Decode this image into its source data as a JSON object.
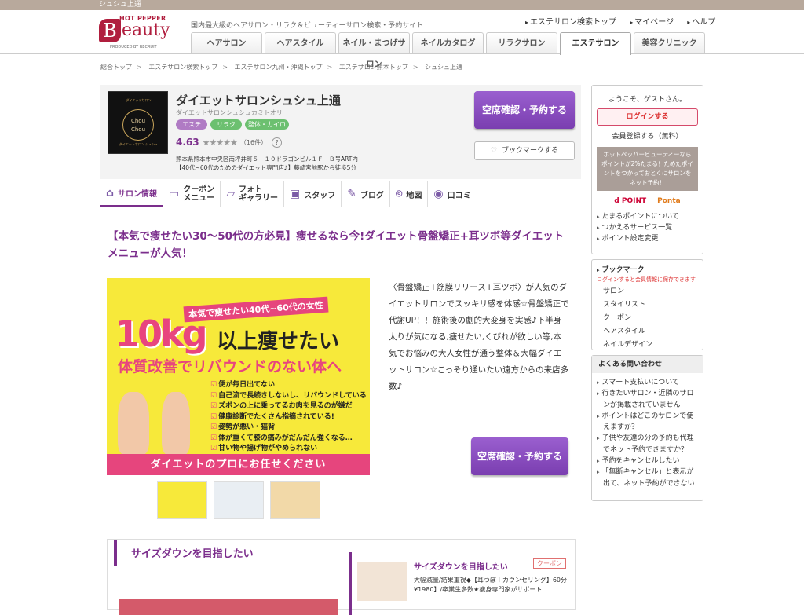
{
  "topstrip": "シュシュ上通",
  "header": {
    "logo_top": "HOT PEPPER",
    "logo_b": "B",
    "logo_rest": "eauty",
    "logo_by": "PRODUCED BY RECRUIT",
    "tagline": "国内最大級のヘアサロン・リラク＆ビューティーサロン検索・予約サイト",
    "links": [
      "エステサロン検索トップ",
      "マイページ",
      "ヘルプ"
    ],
    "nav": [
      "ヘアサロン",
      "ヘアスタイル",
      "ネイル・まつげサロン",
      "ネイルカタログ",
      "リラクサロン",
      "エステサロン",
      "美容クリニック"
    ]
  },
  "breadcrumb": [
    "総合トップ",
    "エステサロン検索トップ",
    "エステサロン九州・沖縄トップ",
    "エステサロン熊本トップ",
    "シュシュ上通"
  ],
  "salon": {
    "thumb_top": "ダイエットサロン",
    "thumb_logo": "Chou Chou",
    "thumb_bottom": "ダイエットサロン シュシュ",
    "name": "ダイエットサロンシュシュ上通",
    "kana": "ダイエットサロンシュシュカミトオリ",
    "tags": [
      "エステ",
      "リラク",
      "整体・カイロ"
    ],
    "rating": "4.63",
    "stars": "★★★★★",
    "reviews": "（16件）",
    "help": "?",
    "address": "熊本県熊本市中央区南坪井町５－１０ドラゴンビル１Ｆ－Ｂ号ART内",
    "access": "【40代~60代のためのダイエット専門店♪】藤崎宮前駅から徒歩5分",
    "reserve_btn": "空席確認・予約する",
    "bookmark_btn": "ブックマークする"
  },
  "subnav": [
    {
      "icon": "⌂",
      "label": "サロン情報"
    },
    {
      "icon": "▭",
      "label": "クーポン\nメニュー"
    },
    {
      "icon": "▱",
      "label": "フォト\nギャラリー"
    },
    {
      "icon": "▣",
      "label": "スタッフ"
    },
    {
      "icon": "✎",
      "label": "ブログ"
    },
    {
      "icon": "⌾",
      "label": "地図"
    },
    {
      "icon": "◉",
      "label": "口コミ"
    }
  ],
  "catch": "【本気で痩せたい30～50代の方必見】痩せるなら今!ダイエット骨盤矯正+耳ツボ等ダイエットメニューが人気！",
  "mainimg": {
    "head": "本気で痩せたい40代~60代の女性",
    "big": "10kg",
    "big2": "以上痩せたい",
    "sub": "体質改善でリバウンドのない体へ",
    "checks": [
      "便が毎日出てない",
      "自己流で長続きしないし、リバウンドしている",
      "ズボンの上に乗ってるお肉を見るのが嫌だ",
      "健康診断でたくさん指摘されている!",
      "姿勢が悪い・猫背",
      "体が重くて膝の痛みがだんだん強くなる…",
      "甘い物や揚げ物がやめられない"
    ],
    "band": "ダイエットのプロにお任せください"
  },
  "desc": "〈骨盤矯正+筋膜リリース+耳ツボ〉が人気のダイエットサロンでスッキリ感を体感☆骨盤矯正で代謝UP！！施術後の劇的大変身を実感♪下半身太りが気になる,痩せたい,くびれが欲しい等,本気でお悩みの大人女性が通う整体＆大幅ダイエットサロン☆こっそり通いたい遠方からの来店多数♪",
  "reserve_btn2": "空席確認・予約する",
  "bottom": {
    "title": "サイズダウンを目指したい",
    "coupon_name": "サイズダウンを目指したい",
    "coupon_tag": "クーポン",
    "coupon_desc": "大幅減量/結果重視◆【耳つぼ＋カウンセリング】60分¥1980】/卒業生多数★痩身専門家がサポート"
  },
  "side": {
    "welcome": "ようこそ、ゲストさん。",
    "login": "ログインする",
    "register": "会員登録する（無料）",
    "point": "ホットペッパービューティーならポイントが2%たまる！ためたポイントをつかっておとくにサロンをネット予約！",
    "dpoint": "d POINT",
    "ponta": "Ponta",
    "links": [
      "たまるポイントについて",
      "つかえるサービス一覧",
      "ポイント設定変更"
    ],
    "bm_title": "ブックマーク",
    "bm_note": "ログインすると会員情報に保存できます",
    "bm_items": [
      "サロン",
      "スタイリスト",
      "クーポン",
      "ヘアスタイル",
      "ネイルデザイン"
    ],
    "faq_title": "よくある問い合わせ",
    "faq": [
      "スマート支払いについて",
      "行きたいサロン・近隣のサロンが掲載されていません",
      "ポイントはどこのサロンで使えますか？",
      "子供や友達の分の予約も代理でネット予約できますか？",
      "予約をキャンセルしたい",
      "「無断キャンセル」と表示が出て、ネット予約ができない"
    ]
  }
}
